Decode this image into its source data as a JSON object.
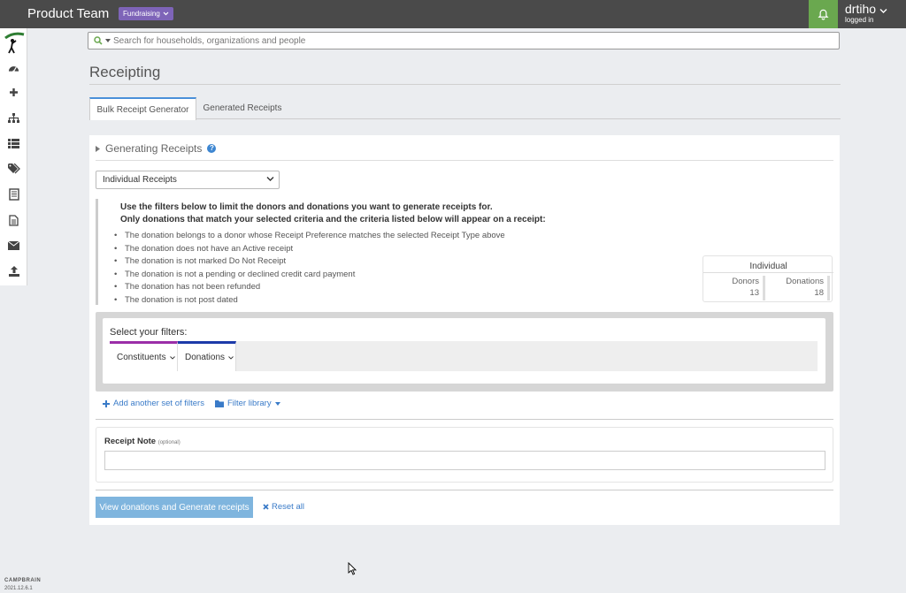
{
  "header": {
    "title": "Product Team",
    "badge": "Fundraising",
    "user_name": "drtiho",
    "user_status": "logged in"
  },
  "search": {
    "placeholder": "Search for households, organizations and people"
  },
  "page": {
    "title": "Receipting"
  },
  "tabs": [
    {
      "label": "Bulk Receipt Generator",
      "active": true
    },
    {
      "label": "Generated Receipts",
      "active": false
    }
  ],
  "section": {
    "heading": "Generating Receipts"
  },
  "receipt_type": {
    "selected": "Individual Receipts"
  },
  "info": {
    "line1": "Use the filters below to limit the donors and donations you want to generate receipts for.",
    "line2": "Only donations that match your selected criteria and the criteria listed below will appear on a receipt:",
    "items": [
      "The donation belongs to a donor whose Receipt Preference matches the selected Receipt Type above",
      "The donation does not have an Active receipt",
      "The donation is not marked Do Not Receipt",
      "The donation is not a pending or declined credit card payment",
      "The donation has not been refunded",
      "The donation is not post dated"
    ]
  },
  "stats": {
    "heading": "Individual",
    "donors_label": "Donors",
    "donors_value": "13",
    "donations_label": "Donations",
    "donations_value": "18"
  },
  "filters": {
    "label": "Select your filters:",
    "tabs": [
      "Constituents",
      "Donations"
    ],
    "add_link": "Add another set of filters",
    "library_link": "Filter library"
  },
  "note": {
    "label": "Receipt Note",
    "optional": "(optional)",
    "value": ""
  },
  "actions": {
    "generate": "View donations and Generate receipts",
    "reset": "Reset all"
  },
  "footer": {
    "brand": "CAMPBRAIN",
    "version": "2021.12.6.1"
  },
  "colors": {
    "topbar": "#4a4a4a",
    "badge": "#7e64b8",
    "bell": "#6aa84f",
    "link": "#3a7bc8",
    "primary_button": "#7fb5de",
    "constituents_accent": "#9b2ea8",
    "donations_accent": "#1c3aa9"
  },
  "icons": {
    "sidebar": [
      "logo-icon",
      "dashboard-icon",
      "plus-icon",
      "sitemap-icon",
      "list-icon",
      "tags-icon",
      "report-icon",
      "document-icon",
      "envelope-icon",
      "upload-icon"
    ]
  }
}
